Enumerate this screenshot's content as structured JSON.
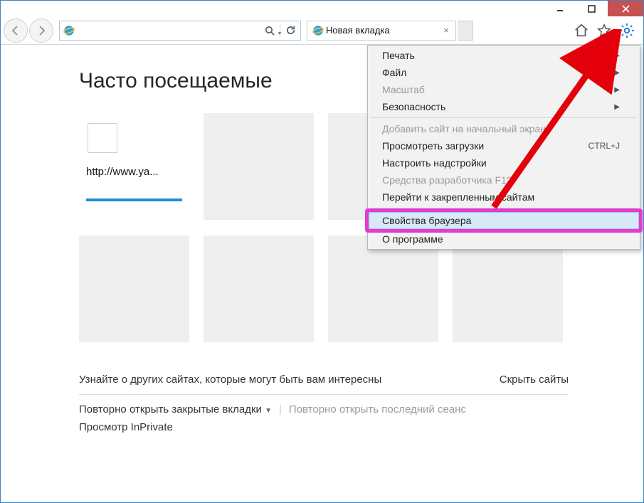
{
  "tab": {
    "title": "Новая вкладка"
  },
  "page": {
    "heading": "Часто посещаемые",
    "tile_url": "http://www.ya...",
    "discover": "Узнайте о других сайтах, которые могут быть вам интересны",
    "hide_sites": "Скрыть сайты",
    "reopen_closed": "Повторно открыть закрытые вкладки",
    "reopen_last": "Повторно открыть последний сеанс",
    "inprivate": "Просмотр InPrivate"
  },
  "menu": {
    "print": "Печать",
    "file": "Файл",
    "zoom": "Масштаб",
    "safety": "Безопасность",
    "add_start": "Добавить сайт на начальный экран",
    "downloads": "Просмотреть загрузки",
    "downloads_shortcut": "CTRL+J",
    "addons": "Настроить надстройки",
    "devtools": "Средства разработчика F12",
    "pinned": "Перейти к закрепленным сайтам",
    "options": "Свойства браузера",
    "about": "О программе"
  }
}
